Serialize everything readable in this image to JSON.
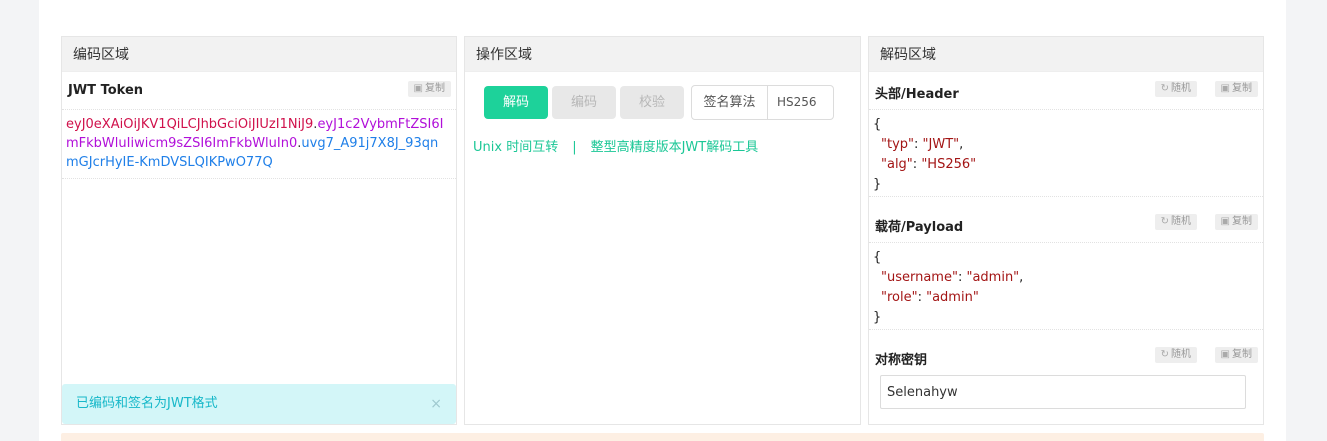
{
  "encode_panel": {
    "title": "编码区域",
    "token_label": "JWT Token",
    "copy_label": "复制",
    "token_header": "eyJ0eXAiOiJKV1QiLCJhbGciOiJIUzI1NiJ9",
    "token_payload": "eyJ1c2VybmFtZSI6ImFkbWluIiwicm9sZSI6ImFkbWluIn0",
    "token_signature": "uvg7_A91j7X8J_93qnmGJcrHyIE-KmDVSLQIKPwO77Q",
    "dot": ".",
    "alert_text": "已编码和签名为JWT格式",
    "alert_close": "×"
  },
  "operate_panel": {
    "title": "操作区域",
    "decode_label": "解码",
    "encode_label": "编码",
    "verify_label": "校验",
    "algo_label": "签名算法",
    "algo_value": "HS256",
    "link_unix": "Unix 时间互转",
    "link_sep": "|",
    "link_tool": "整型高精度版本JWT解码工具"
  },
  "decode_panel": {
    "title": "解码区域",
    "random_label": "随机",
    "copy_label": "复制",
    "header_label": "头部/Header",
    "header_json": {
      "open": "{",
      "close": "}",
      "typ_key": "\"typ\"",
      "typ_val": "\"JWT\"",
      "alg_key": "\"alg\"",
      "alg_val": "\"HS256\""
    },
    "payload_label": "载荷/Payload",
    "payload_json": {
      "open": "{",
      "close": "}",
      "username_key": "\"username\"",
      "username_val": "\"admin\"",
      "role_key": "\"role\"",
      "role_val": "\"admin\""
    },
    "secret_label": "对称密钥",
    "secret_value": "Selenahyw"
  },
  "colors": {
    "accent": "#1dd29a",
    "token_header": "#d0114b",
    "token_payload": "#b10fd9",
    "token_signature": "#1f7fe8"
  }
}
